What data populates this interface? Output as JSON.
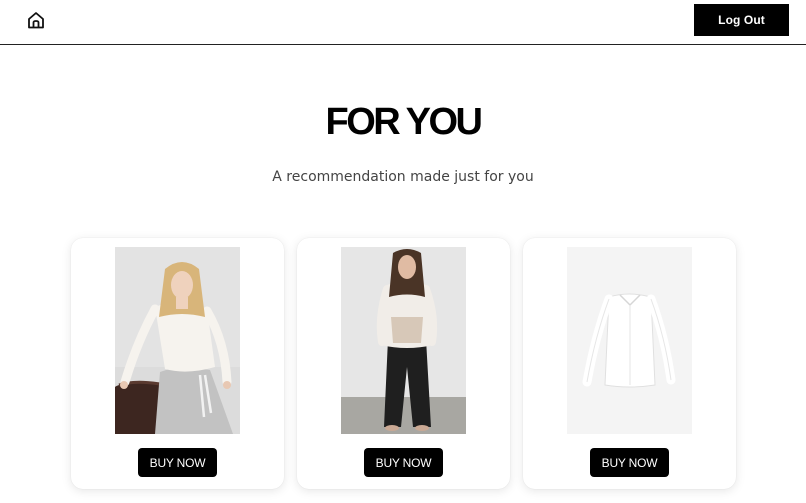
{
  "navbar": {
    "home_icon": "home-icon",
    "logout_label": "Log Out"
  },
  "hero": {
    "title": "FOR YOU",
    "subtitle": "A recommendation made just for you"
  },
  "products": [
    {
      "image": "woman-white-knit-top-grey-sweatpants",
      "buy_label": "BUY NOW"
    },
    {
      "image": "woman-white-shirt-black-trousers",
      "buy_label": "BUY NOW"
    },
    {
      "image": "white-button-shirt",
      "buy_label": "BUY NOW"
    }
  ],
  "colors": {
    "primary": "#000000",
    "background": "#ffffff",
    "subtitle": "#444444"
  }
}
